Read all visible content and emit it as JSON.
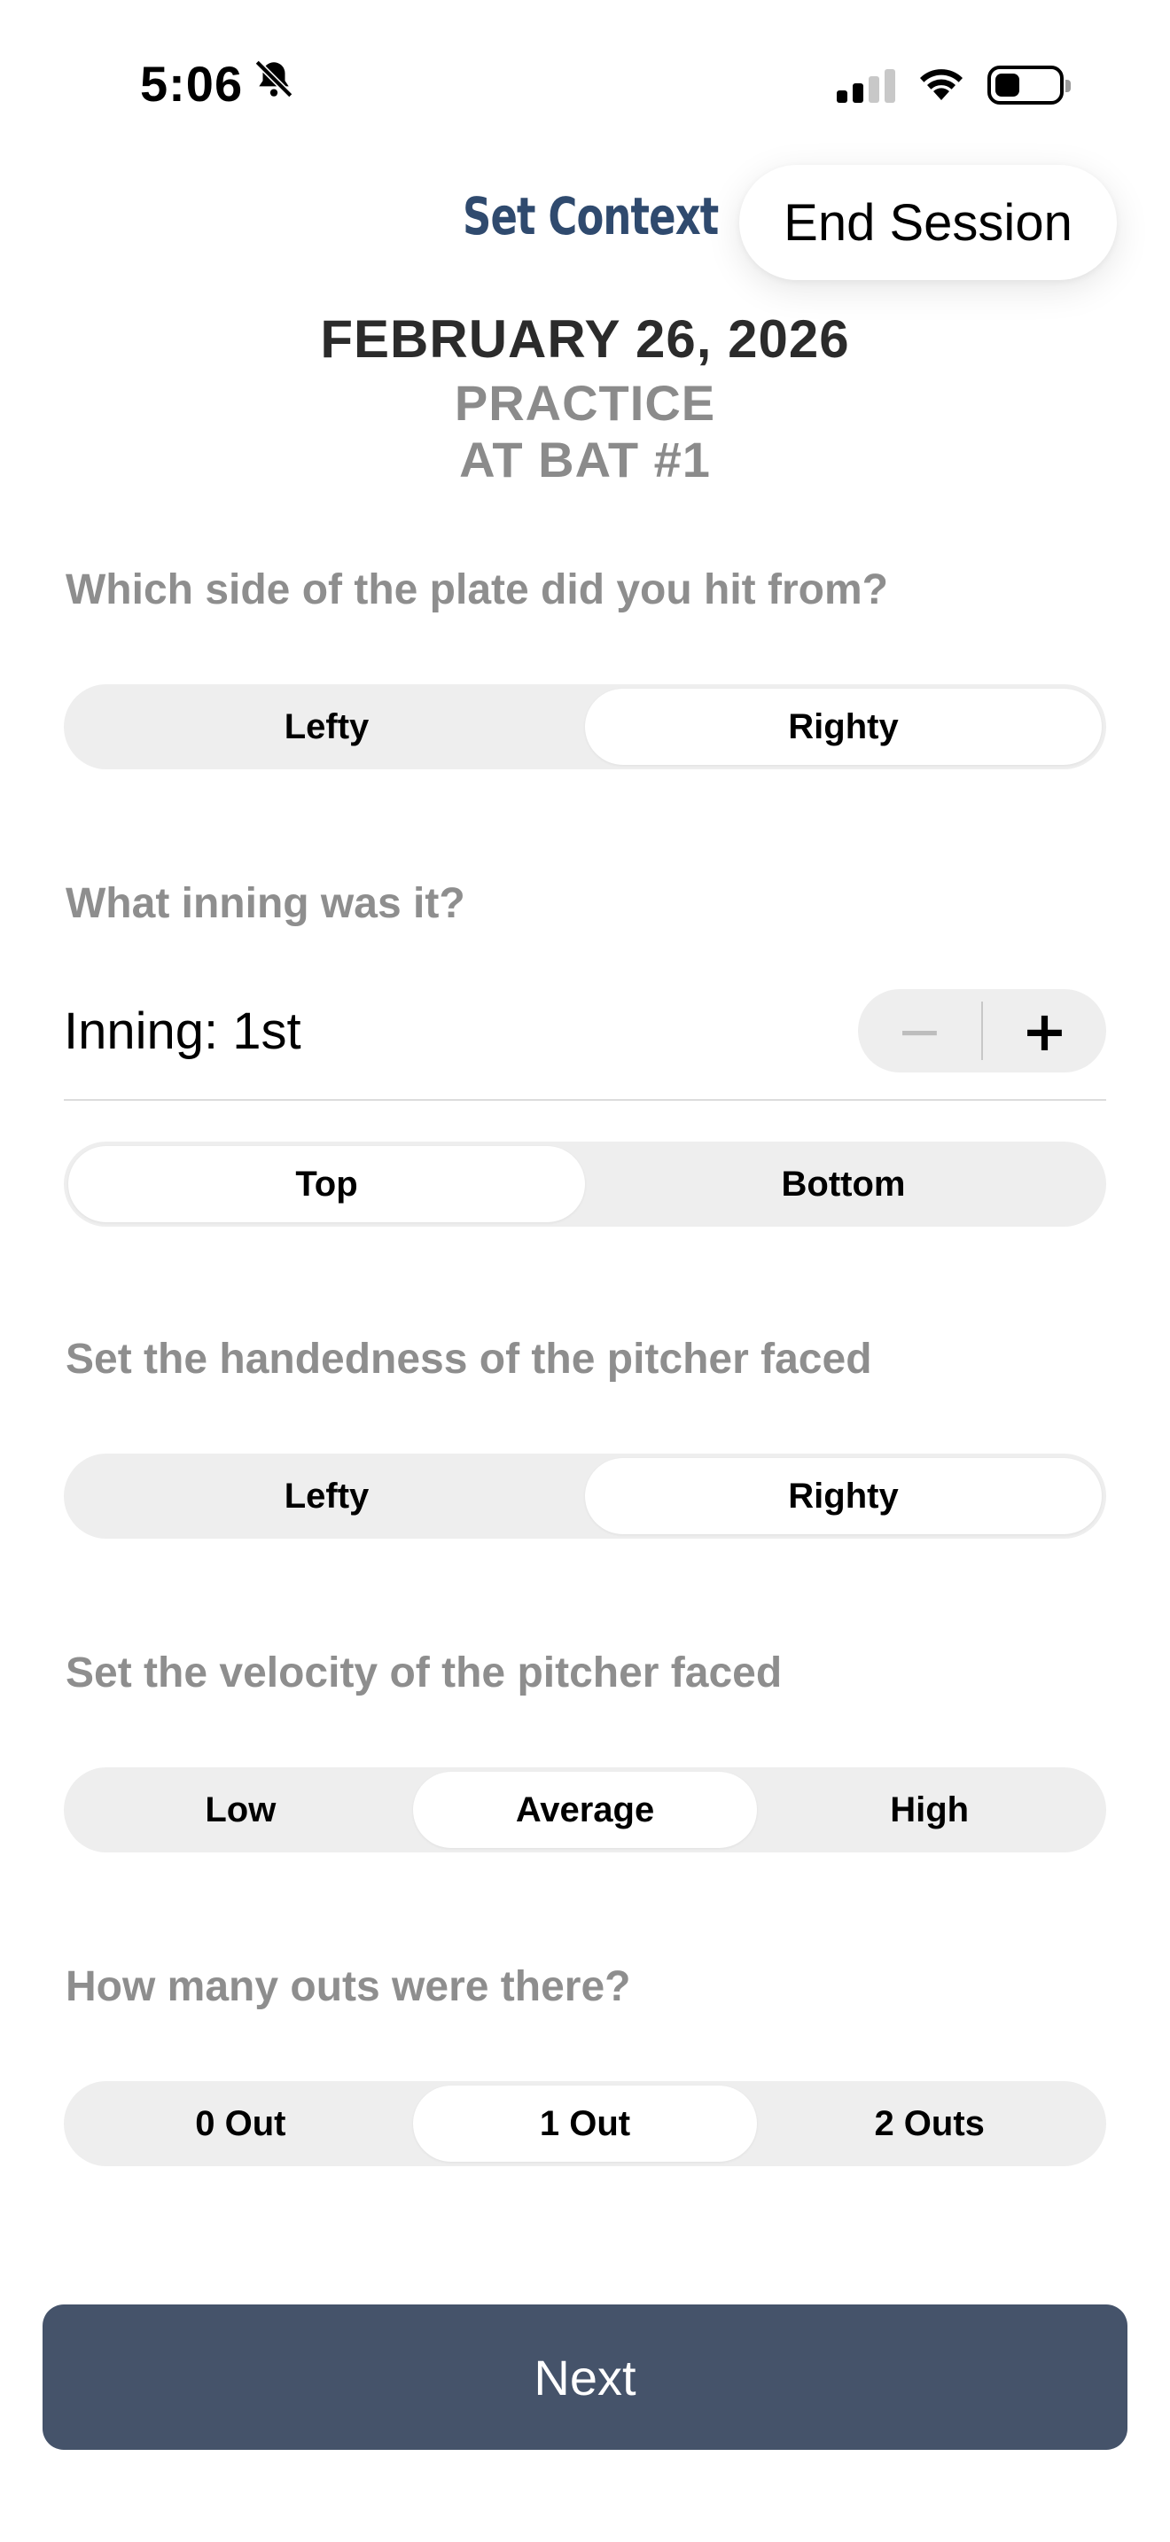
{
  "status_bar": {
    "time": "5:06",
    "icons": [
      "bell-slash-icon",
      "cellular-signal-icon",
      "wifi-icon",
      "battery-icon"
    ],
    "battery_level": 0.35
  },
  "header": {
    "title": "Set Context",
    "end_session_label": "End Session"
  },
  "session": {
    "date": "FEBRUARY 26, 2026",
    "type": "PRACTICE",
    "at_bat": "AT BAT #1"
  },
  "batting_side": {
    "question": "Which side of the plate did you hit from?",
    "options": [
      "Lefty",
      "Righty"
    ],
    "selected": "Righty"
  },
  "inning": {
    "question": "What inning was it?",
    "label": "Inning: 1st",
    "decrement_symbol": "−",
    "increment_symbol": "+",
    "half_options": [
      "Top",
      "Bottom"
    ],
    "selected_half": "Top"
  },
  "pitcher_hand": {
    "question": "Set the handedness of the pitcher faced",
    "options": [
      "Lefty",
      "Righty"
    ],
    "selected": "Righty"
  },
  "velocity": {
    "question": "Set the velocity of the pitcher faced",
    "options": [
      "Low",
      "Average",
      "High"
    ],
    "selected": "Average"
  },
  "outs": {
    "question": "How many outs were there?",
    "options": [
      "0 Out",
      "1 Out",
      "2 Outs"
    ],
    "selected": "1 Out"
  },
  "footer": {
    "next_label": "Next"
  },
  "colors": {
    "accent_navy": "#2f4a6e",
    "button_slate": "#45536a",
    "segment_bg": "#eeeeee",
    "muted_text": "#8e8e8e"
  }
}
